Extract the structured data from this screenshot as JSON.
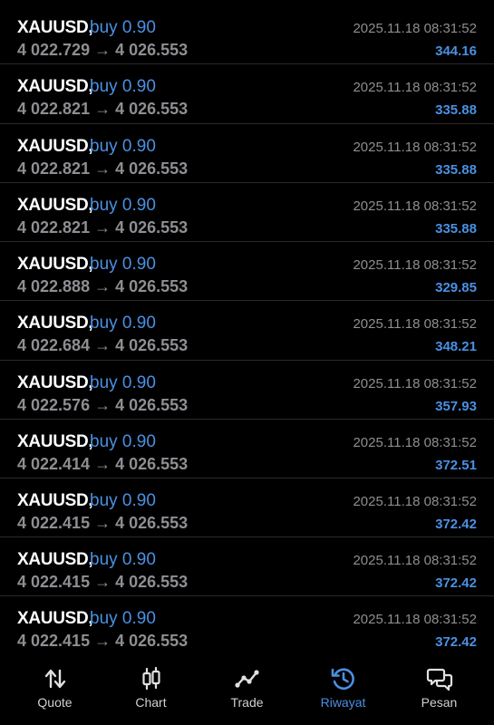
{
  "colors": {
    "background": "#000000",
    "accent": "#4a90e2",
    "muted": "#8e8e93",
    "divider": "#2a2a2a"
  },
  "trades": [
    {
      "symbol": "XAUUSD,",
      "side": "buy 0.90",
      "prices": "4 022.729 → 4 026.553",
      "time": "2025.11.18 08:31:52",
      "profit": "344.16"
    },
    {
      "symbol": "XAUUSD,",
      "side": "buy 0.90",
      "prices": "4 022.821 → 4 026.553",
      "time": "2025.11.18 08:31:52",
      "profit": "335.88"
    },
    {
      "symbol": "XAUUSD,",
      "side": "buy 0.90",
      "prices": "4 022.821 → 4 026.553",
      "time": "2025.11.18 08:31:52",
      "profit": "335.88"
    },
    {
      "symbol": "XAUUSD,",
      "side": "buy 0.90",
      "prices": "4 022.821 → 4 026.553",
      "time": "2025.11.18 08:31:52",
      "profit": "335.88"
    },
    {
      "symbol": "XAUUSD,",
      "side": "buy 0.90",
      "prices": "4 022.888 → 4 026.553",
      "time": "2025.11.18 08:31:52",
      "profit": "329.85"
    },
    {
      "symbol": "XAUUSD,",
      "side": "buy 0.90",
      "prices": "4 022.684 → 4 026.553",
      "time": "2025.11.18 08:31:52",
      "profit": "348.21"
    },
    {
      "symbol": "XAUUSD,",
      "side": "buy 0.90",
      "prices": "4 022.576 → 4 026.553",
      "time": "2025.11.18 08:31:52",
      "profit": "357.93"
    },
    {
      "symbol": "XAUUSD,",
      "side": "buy 0.90",
      "prices": "4 022.414 → 4 026.553",
      "time": "2025.11.18 08:31:52",
      "profit": "372.51"
    },
    {
      "symbol": "XAUUSD,",
      "side": "buy 0.90",
      "prices": "4 022.415 → 4 026.553",
      "time": "2025.11.18 08:31:52",
      "profit": "372.42"
    },
    {
      "symbol": "XAUUSD,",
      "side": "buy 0.90",
      "prices": "4 022.415 → 4 026.553",
      "time": "2025.11.18 08:31:52",
      "profit": "372.42"
    },
    {
      "symbol": "XAUUSD,",
      "side": "buy 0.90",
      "prices": "4 022.415 → 4 026.553",
      "time": "2025.11.18 08:31:52",
      "profit": "372.42"
    }
  ],
  "nav": {
    "items": [
      {
        "label": "Quote",
        "icon": "quote-arrows-icon",
        "active": false
      },
      {
        "label": "Chart",
        "icon": "candlestick-chart-icon",
        "active": false
      },
      {
        "label": "Trade",
        "icon": "trade-line-icon",
        "active": false
      },
      {
        "label": "Riwayat",
        "icon": "history-clock-icon",
        "active": true
      },
      {
        "label": "Pesan",
        "icon": "messages-icon",
        "active": false
      }
    ]
  }
}
